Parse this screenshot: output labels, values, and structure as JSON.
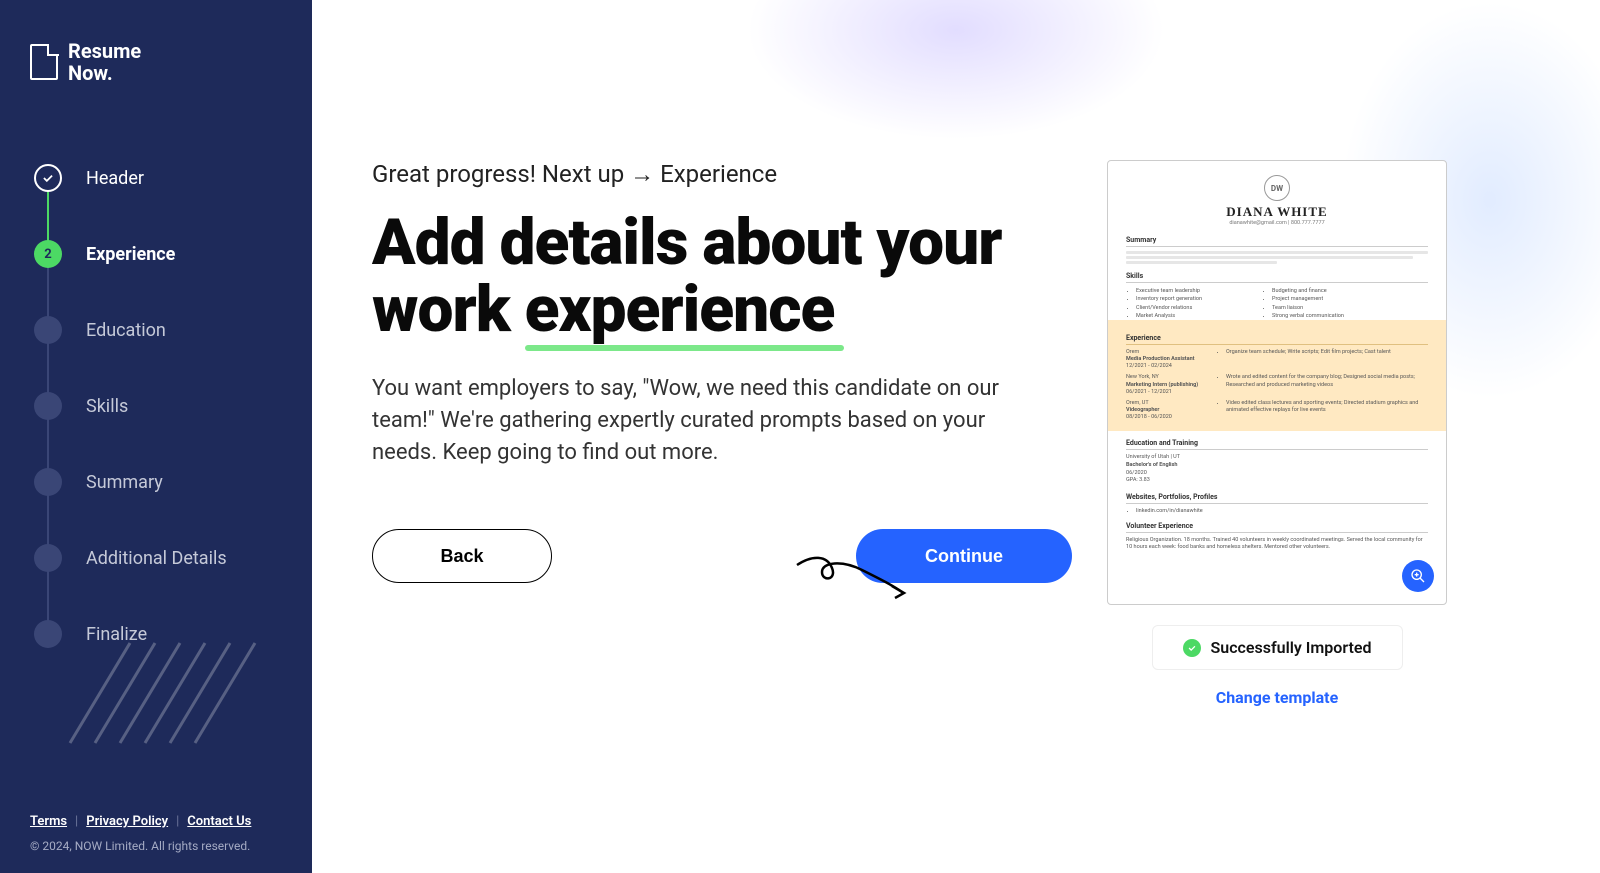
{
  "brand": {
    "line1": "Resume",
    "line2": "Now."
  },
  "steps": [
    {
      "label": "Header",
      "state": "completed"
    },
    {
      "label": "Experience",
      "state": "active",
      "number": "2"
    },
    {
      "label": "Education",
      "state": "pending"
    },
    {
      "label": "Skills",
      "state": "pending"
    },
    {
      "label": "Summary",
      "state": "pending"
    },
    {
      "label": "Additional Details",
      "state": "pending"
    },
    {
      "label": "Finalize",
      "state": "pending"
    }
  ],
  "footer": {
    "terms": "Terms",
    "privacy": "Privacy Policy",
    "contact": "Contact Us",
    "copyright": "© 2024, NOW Limited. All rights reserved."
  },
  "content": {
    "progress": "Great progress! Next up → Experience",
    "headline_part1": "Add details about your work ",
    "headline_underlined": "experience",
    "description": "You want employers to say, \"Wow, we need this candidate on our team!\" We're gathering expertly curated prompts based on your needs. Keep going to find out more.",
    "back": "Back",
    "continue": "Continue"
  },
  "preview": {
    "initials": "DW",
    "name": "DIANA WHITE",
    "contact": "dianawhite@gmail.com  |  800.777.7777",
    "summary_title": "Summary",
    "skills_title": "Skills",
    "skills_left": [
      "Executive team leadership",
      "Inventory report generation",
      "Client/Vendor relations",
      "Market Analysis"
    ],
    "skills_right": [
      "Budgeting and finance",
      "Project management",
      "Team liaison",
      "Strong verbal communication"
    ],
    "experience_title": "Experience",
    "jobs": [
      {
        "loc": "Orem",
        "title": "Media Production Assistant",
        "dates": "12/2021 - 02/2024",
        "bullet": "Organize team schedule; Write scripts; Edit film projects; Cast talent"
      },
      {
        "loc": "New York, NY",
        "title": "Marketing Intern (publishing)",
        "dates": "06/2021 - 12/2021",
        "bullet": "Wrote and edited content for the company blog; Designed social media posts; Researched and produced marketing videos"
      },
      {
        "loc": "Orem, UT",
        "title": "Videographer",
        "dates": "08/2018 - 06/2020",
        "bullet": "Video edited class lectures and sporting events; Directed stadium graphics and animated effective replays for live events"
      }
    ],
    "education_title": "Education and Training",
    "edu_inst": "University of Utah | UT",
    "edu_degree": "Bachelor's of English",
    "edu_date": "06/2020",
    "edu_gpa": "GPA: 3.83",
    "websites_title": "Websites, Portfolios, Profiles",
    "website": "linkedin.com/in/dianawhite",
    "volunteer_title": "Volunteer Experience",
    "volunteer_text": "Religious Organization. 18 months. Trained 40 volunteers in weekly coordinated meetings. Served the local community for 10 hours each week: food banks and homeless shelters. Mentored other volunteers."
  },
  "import_status": "Successfully Imported",
  "change_template": "Change template"
}
